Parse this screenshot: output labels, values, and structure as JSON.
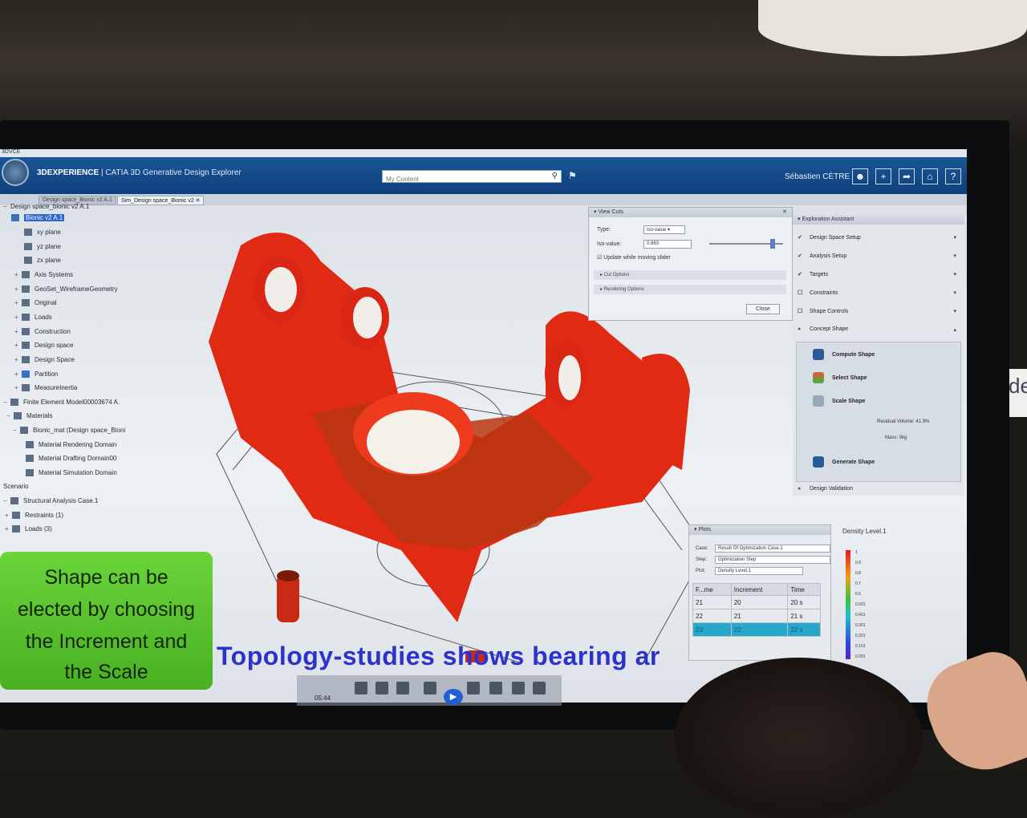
{
  "window": {
    "strip_label": "3DVCE",
    "brand": "3DEXPERIENCE",
    "product": "CATIA 3D Generative Design Explorer",
    "search_placeholder": "My Content",
    "user": "Sébastien CÈTRE"
  },
  "tabs": [
    "Design space_Bionic v2 A.1",
    "Sim_Design space_Bionic v2"
  ],
  "tree": {
    "root": "Design space_bionic v2 A.1",
    "selected": "Bionic v2 A.1",
    "items": [
      "xy plane",
      "yz plane",
      "zx plane",
      "Axis Systems",
      "GeoSet_WireframeGeometry",
      "Original",
      "Loads",
      "Construction",
      "Design space",
      "Design Space",
      "Partition",
      "MeasureInertia"
    ],
    "fem": "Finite Element Model00003674 A.",
    "materials": "Materials",
    "material_items": [
      "Bionic_mat (Design space_Bioni",
      "Material Rendering Domain",
      "Material Drafting Domain00",
      "Material Simulation Domain"
    ],
    "scenario": "Scenario",
    "case": "Structural Analysis Case.1",
    "restraints": "Restraints (1)",
    "loads": "Loads (3)"
  },
  "view_cuts": {
    "title": "View Cuts",
    "type_label": "Type:",
    "type_value": "Iso-value",
    "iso_label": "Iso-value:",
    "iso_value": "0.863",
    "update_label": "Update while moving slider",
    "cut_options": "Cut Options",
    "rendering_options": "Rendering Options",
    "close": "Close"
  },
  "assistant": {
    "title": "Exploration Assistant",
    "steps": [
      "Design Space Setup",
      "Analysis Setup",
      "Targets",
      "Constraints",
      "Shape Controls",
      "Concept Shape"
    ],
    "compute": "Compute Shape",
    "select": "Select Shape",
    "scale": "Scale Shape",
    "residual": "Residual Volume: 41.9%",
    "mass": "Mass: 0kg",
    "generate": "Generate Shape",
    "validation": "Design Validation"
  },
  "plots": {
    "title": "Plots",
    "case_label": "Case:",
    "case_value": "Result Of Optimization Case.1",
    "step_label": "Step:",
    "step_value": "Optimization Step",
    "plot_label": "Plot:",
    "plot_value": "Density Level.1",
    "headers": [
      "F...me",
      "Increment",
      "Time"
    ],
    "rows": [
      [
        "21",
        "20",
        "20 s"
      ],
      [
        "22",
        "21",
        "21 s"
      ],
      [
        "23",
        "22",
        "22 s"
      ]
    ]
  },
  "density": {
    "title": "Density Level.1",
    "labels": [
      "1",
      "0.9",
      "0.8",
      "0.7",
      "0.6",
      "0.501",
      "0.401",
      "0.301",
      "0.201",
      "0.101",
      "0.001"
    ]
  },
  "overlay": {
    "green_lines": [
      "Shape can be",
      "elected by choosing",
      "the Increment and",
      "the Scale"
    ],
    "subtitle": "Topology-studies shows bearing ar",
    "time": "05:44"
  }
}
